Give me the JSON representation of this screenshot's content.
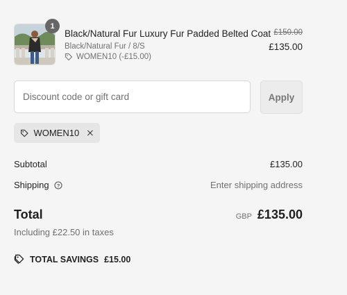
{
  "line_item": {
    "quantity": "1",
    "name": "Black/Natural Fur Luxury Fur Padded Belted Coat",
    "variant": "Black/Natural Fur / 8/S",
    "discount": "WOMEN10 (-£15.00)",
    "original_price": "£150.00",
    "price": "£135.00",
    "thumbnail_icon": "product-photo"
  },
  "discount": {
    "placeholder": "Discount code or gift card",
    "value": "",
    "apply_label": "Apply",
    "applied_code": "WOMEN10"
  },
  "summary": {
    "subtotal_label": "Subtotal",
    "subtotal_value": "£135.00",
    "shipping_label": "Shipping",
    "shipping_value": "Enter shipping address",
    "total_label": "Total",
    "currency": "GBP",
    "total_value": "£135.00",
    "tax_note": "Including £22.50 in taxes",
    "savings_label": "TOTAL SAVINGS",
    "savings_value": "£15.00"
  },
  "icons": {
    "tag": "tag-icon",
    "close": "close-icon",
    "info": "info-icon",
    "savings": "savings-tag-icon"
  },
  "colors": {
    "background": "#f5f5f5",
    "badge": "#666666",
    "muted_text": "#707070",
    "chip_bg": "#e6e6e6"
  }
}
